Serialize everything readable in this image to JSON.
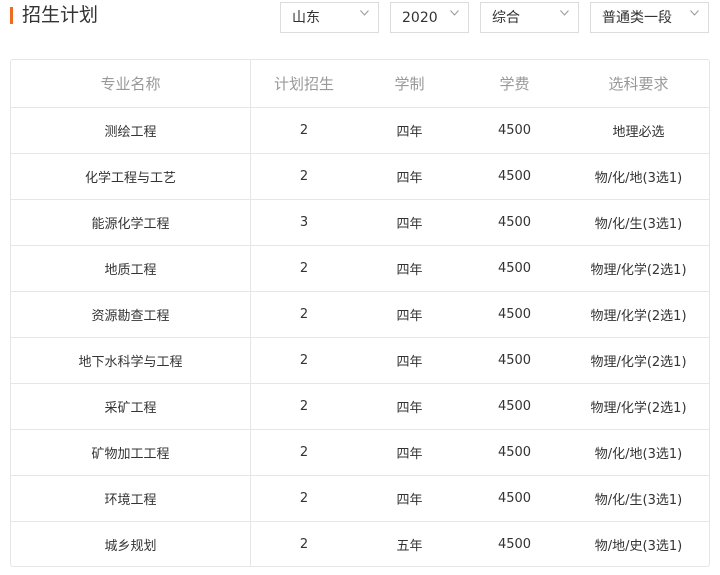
{
  "header": {
    "title": "招生计划",
    "accent_color": "#f26a1b"
  },
  "filters": {
    "province": "山东",
    "year": "2020",
    "category": "综合",
    "batch": "普通类一段",
    "chevron_icon": "chevron-down-icon"
  },
  "table": {
    "columns": [
      "专业名称",
      "计划招生",
      "学制",
      "学费",
      "选科要求"
    ],
    "rows": [
      {
        "name": "测绘工程",
        "plan": "2",
        "years": "四年",
        "fee": "4500",
        "req": "地理必选"
      },
      {
        "name": "化学工程与工艺",
        "plan": "2",
        "years": "四年",
        "fee": "4500",
        "req": "物/化/地(3选1)"
      },
      {
        "name": "能源化学工程",
        "plan": "3",
        "years": "四年",
        "fee": "4500",
        "req": "物/化/生(3选1)"
      },
      {
        "name": "地质工程",
        "plan": "2",
        "years": "四年",
        "fee": "4500",
        "req": "物理/化学(2选1)"
      },
      {
        "name": "资源勘查工程",
        "plan": "2",
        "years": "四年",
        "fee": "4500",
        "req": "物理/化学(2选1)"
      },
      {
        "name": "地下水科学与工程",
        "plan": "2",
        "years": "四年",
        "fee": "4500",
        "req": "物理/化学(2选1)"
      },
      {
        "name": "采矿工程",
        "plan": "2",
        "years": "四年",
        "fee": "4500",
        "req": "物理/化学(2选1)"
      },
      {
        "name": "矿物加工工程",
        "plan": "2",
        "years": "四年",
        "fee": "4500",
        "req": "物/化/地(3选1)"
      },
      {
        "name": "环境工程",
        "plan": "2",
        "years": "四年",
        "fee": "4500",
        "req": "物/化/生(3选1)"
      },
      {
        "name": "城乡规划",
        "plan": "2",
        "years": "五年",
        "fee": "4500",
        "req": "物/地/史(3选1)"
      }
    ]
  }
}
